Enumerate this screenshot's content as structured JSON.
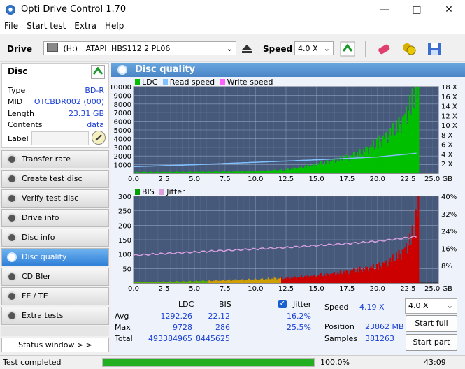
{
  "window": {
    "title": "Opti Drive Control 1.70"
  },
  "menu": [
    "File",
    "Start test",
    "Extra",
    "Help"
  ],
  "toolbar": {
    "drive_label": "Drive",
    "drive_letter": "(H:)",
    "drive_value": "ATAPI iHBS112   2 PL06",
    "speed_label": "Speed",
    "speed_value": "4.0 X"
  },
  "disc": {
    "header": "Disc",
    "rows": [
      {
        "label": "Type",
        "value": "BD-R"
      },
      {
        "label": "MID",
        "value": "OTCBDR002 (000)"
      },
      {
        "label": "Length",
        "value": "23.31 GB"
      },
      {
        "label": "Contents",
        "value": "data"
      },
      {
        "label": "Label",
        "value": ""
      }
    ]
  },
  "nav": [
    "Transfer rate",
    "Create test disc",
    "Verify test disc",
    "Drive info",
    "Disc info",
    "Disc quality",
    "CD Bler",
    "FE / TE",
    "Extra tests"
  ],
  "nav_active": "Disc quality",
  "status_window_btn": "Status window > >",
  "main": {
    "title": "Disc quality"
  },
  "legend_top": [
    "LDC",
    "Read speed",
    "Write speed"
  ],
  "legend_bottom": [
    "BIS",
    "Jitter"
  ],
  "colors": {
    "ldc": "#00c000",
    "read": "#80c0ff",
    "write": "#ff60ff",
    "bis": "#cc0000",
    "jitter": "#e0a0e0"
  },
  "chart_data": [
    {
      "type": "area",
      "x_ticks": [
        "0.0",
        "2.5",
        "5.0",
        "7.5",
        "10.0",
        "12.5",
        "15.0",
        "17.5",
        "20.0",
        "22.5",
        "25.0 GB"
      ],
      "y_left_ticks": [
        "10000",
        "9000",
        "8000",
        "7000",
        "6000",
        "5000",
        "4000",
        "3000",
        "2000",
        "1000"
      ],
      "y_right_ticks": [
        "18 X",
        "16 X",
        "14 X",
        "12 X",
        "10 X",
        "8 X",
        "6 X",
        "4 X",
        "2 X"
      ],
      "xlim": [
        0,
        25
      ],
      "ylim": [
        0,
        10000
      ],
      "y2lim": [
        0,
        18
      ],
      "series": [
        {
          "name": "LDC",
          "x": [
            0,
            2.5,
            5,
            7.5,
            10,
            12.5,
            14,
            15,
            16,
            17.5,
            18.5,
            19.5,
            20,
            21,
            22,
            22.5,
            23,
            23.31
          ],
          "y": [
            150,
            170,
            190,
            210,
            260,
            450,
            800,
            1100,
            1400,
            1900,
            2400,
            3200,
            3700,
            4800,
            6200,
            7800,
            9200,
            9728
          ]
        },
        {
          "name": "Read speed",
          "x": [
            0,
            5,
            10,
            15,
            20,
            23.31
          ],
          "y": [
            1.4,
            1.8,
            2.3,
            2.8,
            3.4,
            4.19
          ]
        }
      ]
    },
    {
      "type": "area",
      "x_ticks": [
        "0.0",
        "2.5",
        "5.0",
        "7.5",
        "10.0",
        "12.5",
        "15.0",
        "17.5",
        "20.0",
        "22.5",
        "25.0 GB"
      ],
      "y_left_ticks": [
        "300",
        "250",
        "200",
        "150",
        "100",
        "50"
      ],
      "y_right_ticks": [
        "40%",
        "32%",
        "24%",
        "16%",
        "8%"
      ],
      "xlim": [
        0,
        25
      ],
      "ylim": [
        0,
        300
      ],
      "y2lim": [
        0,
        40
      ],
      "series": [
        {
          "name": "BIS",
          "x": [
            0,
            2.5,
            5,
            7.5,
            10,
            12.5,
            15,
            17.5,
            20,
            21,
            22,
            22.5,
            23,
            23.31
          ],
          "y": [
            3,
            5,
            7,
            10,
            13,
            18,
            27,
            40,
            60,
            80,
            110,
            140,
            200,
            286
          ]
        },
        {
          "name": "Jitter",
          "x": [
            0,
            2.5,
            5,
            7.5,
            10,
            12.5,
            15,
            17.5,
            20,
            22.5,
            23.31
          ],
          "y": [
            12.8,
            13.6,
            14.3,
            15.0,
            15.7,
            16.4,
            17.3,
            18.2,
            19.3,
            21.0,
            21.5
          ]
        }
      ]
    }
  ],
  "stats": {
    "col_ldc": "LDC",
    "col_bis": "BIS",
    "jitter_label": "Jitter",
    "avg_label": "Avg",
    "max_label": "Max",
    "total_label": "Total",
    "avg_ldc": "1292.26",
    "avg_bis": "22.12",
    "avg_jitter": "16.2%",
    "max_ldc": "9728",
    "max_bis": "286",
    "max_jitter": "25.5%",
    "total_ldc": "493384965",
    "total_bis": "8445625",
    "speed_label": "Speed",
    "speed_value": "4.19 X",
    "position_label": "Position",
    "position_value": "23862 MB",
    "samples_label": "Samples",
    "samples_value": "381263",
    "speed_select": "4.0 X",
    "start_full": "Start full",
    "start_part": "Start part"
  },
  "status": {
    "text": "Test completed",
    "progress_label": "100.0%",
    "progress": 1.0,
    "time": "43:09"
  }
}
